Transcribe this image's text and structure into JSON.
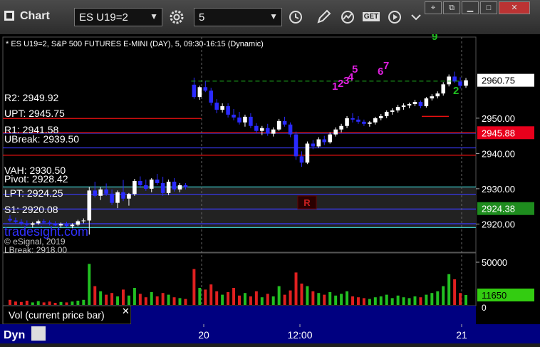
{
  "window": {
    "title": "Chart"
  },
  "toolbar": {
    "symbol": "ES U19=2",
    "interval": "5",
    "studies_label": "GET"
  },
  "chart_data": {
    "type": "candlestick",
    "title": "* ES U19=2, S&P 500 FUTURES E-MINI (DAY), 5, 09:30-16:15 (Dynamic)",
    "ylim": [
      2912,
      2973
    ],
    "y_ticks": [
      2920.0,
      2930.0,
      2940.0,
      2950.0
    ],
    "x_tick_labels": [
      "20",
      "12:00",
      "21"
    ],
    "last_price": 2960.75,
    "price_tags": [
      {
        "value": 2960.75,
        "label": "2960.75",
        "bg": "#ffffff",
        "fg": "#000000"
      },
      {
        "value": 2945.88,
        "label": "2945.88",
        "bg": "#e8001c",
        "fg": "#ffffff"
      },
      {
        "value": 2924.38,
        "label": "2924.38",
        "bg": "#1e8c1e",
        "fg": "#ffffff"
      }
    ],
    "levels": [
      {
        "label": "R2: 2949.92",
        "value": 2949.92,
        "color": "#e81010"
      },
      {
        "label": "UPT: 2945.75",
        "value": 2945.75,
        "color": "#3b3bff"
      },
      {
        "label": "R1: 2941.58",
        "value": 2941.58,
        "color": "#3b3bff"
      },
      {
        "label": "UBreak: 2939.50",
        "value": 2939.5,
        "color": "#e81010"
      },
      {
        "label": "VAH: 2930.50",
        "value": 2930.5,
        "color": "#3cc8c8"
      },
      {
        "label": "Pivot: 2928.42",
        "value": 2928.42,
        "color": "#3b3bff"
      },
      {
        "label": "LPT: 2924.25",
        "value": 2924.25,
        "color": "#3b3bff"
      },
      {
        "label": "S1: 2920.08",
        "value": 2920.08,
        "color": "#3b3bff"
      }
    ],
    "level_lines_extra": [
      {
        "value": 2945.88,
        "color": "#e81010"
      },
      {
        "value": 2919.0,
        "color": "#3cc8c8"
      }
    ],
    "value_area": [
      2919.0,
      2930.5
    ],
    "annotations": [
      {
        "text": "1",
        "color": "#e020e0"
      },
      {
        "text": "2",
        "color": "#e020e0"
      },
      {
        "text": "3",
        "color": "#e020e0"
      },
      {
        "text": "4",
        "color": "#e020e0"
      },
      {
        "text": "5",
        "color": "#e020e0"
      },
      {
        "text": "6",
        "color": "#e020e0"
      },
      {
        "text": "7",
        "color": "#e020e0"
      },
      {
        "text": "9",
        "color": "#20c020"
      },
      {
        "text": "2",
        "color": "#20c020"
      }
    ],
    "marker": "R",
    "watermark": "tradesight.com",
    "copyright": "© eSignal, 2019",
    "partial_label": "LBreak: 2918.00",
    "volume": {
      "ylim": [
        0,
        60000
      ],
      "ticks": [
        50000
      ],
      "tick_labels": [
        "50000"
      ],
      "zero_label": "0",
      "last_value": 11650,
      "last_label": "11650"
    },
    "candles": [
      [
        2921.5,
        2922.5,
        2920.5,
        2921.0
      ],
      [
        2921.0,
        2921.8,
        2920.2,
        2920.6
      ],
      [
        2920.6,
        2921.4,
        2919.6,
        2920.2
      ],
      [
        2920.2,
        2921.0,
        2919.4,
        2919.8
      ],
      [
        2919.8,
        2920.6,
        2919.0,
        2920.2
      ],
      [
        2920.2,
        2921.2,
        2919.8,
        2920.8
      ],
      [
        2920.8,
        2921.4,
        2920.0,
        2920.4
      ],
      [
        2920.4,
        2921.0,
        2919.6,
        2920.0
      ],
      [
        2920.0,
        2920.8,
        2919.4,
        2919.6
      ],
      [
        2919.6,
        2920.4,
        2919.0,
        2920.0
      ],
      [
        2920.0,
        2920.6,
        2919.2,
        2919.4
      ],
      [
        2919.4,
        2920.2,
        2918.8,
        2919.8
      ],
      [
        2919.8,
        2921.2,
        2919.4,
        2920.8
      ],
      [
        2920.8,
        2921.6,
        2920.2,
        2921.0
      ],
      [
        2921.0,
        2930.5,
        2917.0,
        2929.5
      ],
      [
        2929.5,
        2932.0,
        2927.5,
        2928.0
      ],
      [
        2928.0,
        2930.5,
        2926.8,
        2929.8
      ],
      [
        2929.8,
        2931.5,
        2928.0,
        2928.6
      ],
      [
        2928.6,
        2929.8,
        2925.4,
        2926.0
      ],
      [
        2926.0,
        2929.5,
        2924.5,
        2929.0
      ],
      [
        2929.0,
        2932.5,
        2926.5,
        2927.2
      ],
      [
        2927.2,
        2928.8,
        2925.2,
        2928.5
      ],
      [
        2928.5,
        2932.8,
        2928.0,
        2932.2
      ],
      [
        2932.2,
        2933.5,
        2930.2,
        2931.0
      ],
      [
        2931.0,
        2932.6,
        2929.4,
        2930.0
      ],
      [
        2930.0,
        2933.0,
        2929.0,
        2932.6
      ],
      [
        2932.6,
        2934.2,
        2931.0,
        2931.6
      ],
      [
        2931.6,
        2933.4,
        2928.0,
        2928.8
      ],
      [
        2928.8,
        2932.6,
        2928.2,
        2932.0
      ],
      [
        2932.0,
        2933.0,
        2929.2,
        2929.8
      ],
      [
        2929.8,
        2931.6,
        2929.0,
        2931.0
      ],
      [
        2931.0,
        2931.6,
        2929.8,
        2930.4
      ],
      [
        2959.5,
        2961.5,
        2955.5,
        2956.0
      ],
      [
        2956.0,
        2959.2,
        2955.2,
        2958.8
      ],
      [
        2958.8,
        2960.6,
        2957.4,
        2957.8
      ],
      [
        2957.8,
        2958.6,
        2953.6,
        2954.4
      ],
      [
        2954.4,
        2955.4,
        2951.4,
        2952.4
      ],
      [
        2952.4,
        2954.2,
        2951.6,
        2953.4
      ],
      [
        2953.4,
        2954.2,
        2950.2,
        2951.0
      ],
      [
        2951.0,
        2952.6,
        2949.4,
        2950.2
      ],
      [
        2950.2,
        2951.8,
        2948.2,
        2948.8
      ],
      [
        2948.8,
        2951.0,
        2947.6,
        2950.4
      ],
      [
        2950.4,
        2951.4,
        2947.2,
        2947.8
      ],
      [
        2947.8,
        2948.6,
        2945.8,
        2946.4
      ],
      [
        2946.4,
        2947.8,
        2945.2,
        2947.2
      ],
      [
        2947.2,
        2948.4,
        2945.0,
        2945.6
      ],
      [
        2945.6,
        2947.4,
        2944.8,
        2946.8
      ],
      [
        2946.8,
        2949.8,
        2946.4,
        2949.2
      ],
      [
        2949.2,
        2950.4,
        2947.6,
        2948.2
      ],
      [
        2948.2,
        2948.8,
        2944.6,
        2945.4
      ],
      [
        2945.4,
        2946.2,
        2938.2,
        2939.2
      ],
      [
        2939.2,
        2940.6,
        2936.2,
        2937.4
      ],
      [
        2937.4,
        2943.4,
        2937.0,
        2942.8
      ],
      [
        2942.8,
        2943.8,
        2941.2,
        2942.0
      ],
      [
        2942.0,
        2944.6,
        2941.6,
        2944.0
      ],
      [
        2944.0,
        2945.0,
        2942.4,
        2943.2
      ],
      [
        2943.2,
        2946.0,
        2942.8,
        2945.4
      ],
      [
        2945.4,
        2947.4,
        2944.8,
        2946.8
      ],
      [
        2946.8,
        2948.4,
        2946.0,
        2947.8
      ],
      [
        2947.8,
        2950.6,
        2947.2,
        2950.0
      ],
      [
        2950.0,
        2951.4,
        2948.8,
        2949.6
      ],
      [
        2949.6,
        2950.6,
        2948.4,
        2949.0
      ],
      [
        2949.0,
        2949.6,
        2947.8,
        2948.4
      ],
      [
        2948.4,
        2949.2,
        2947.6,
        2948.8
      ],
      [
        2948.8,
        2950.4,
        2948.2,
        2950.0
      ],
      [
        2950.0,
        2951.2,
        2949.4,
        2950.6
      ],
      [
        2950.6,
        2952.2,
        2950.0,
        2951.8
      ],
      [
        2951.8,
        2952.8,
        2951.0,
        2952.2
      ],
      [
        2952.2,
        2953.8,
        2951.6,
        2953.2
      ],
      [
        2953.2,
        2954.2,
        2952.4,
        2953.6
      ],
      [
        2953.6,
        2954.4,
        2952.8,
        2954.0
      ],
      [
        2954.0,
        2955.2,
        2953.4,
        2954.6
      ],
      [
        2954.6,
        2955.0,
        2952.8,
        2953.4
      ],
      [
        2953.4,
        2956.0,
        2953.0,
        2955.6
      ],
      [
        2955.6,
        2956.8,
        2955.0,
        2956.2
      ],
      [
        2956.2,
        2957.6,
        2955.6,
        2957.0
      ],
      [
        2957.0,
        2960.2,
        2956.4,
        2959.6
      ],
      [
        2959.6,
        2962.4,
        2959.0,
        2961.8
      ],
      [
        2961.8,
        2963.2,
        2960.0,
        2960.4
      ],
      [
        2960.4,
        2961.6,
        2958.4,
        2959.2
      ],
      [
        2959.2,
        2961.4,
        2958.6,
        2960.75
      ]
    ],
    "volumes": [
      6000,
      4000,
      3500,
      5000,
      3000,
      4500,
      3000,
      4000,
      2500,
      3500,
      3000,
      4000,
      5000,
      6000,
      48000,
      22000,
      16000,
      12000,
      14000,
      10000,
      18000,
      11000,
      20000,
      13000,
      9000,
      15000,
      10000,
      14000,
      12000,
      9000,
      8000,
      7000,
      42000,
      20000,
      18000,
      24000,
      16000,
      12000,
      15000,
      20000,
      11000,
      14000,
      10000,
      16000,
      9000,
      13000,
      10000,
      22000,
      12000,
      17000,
      38000,
      25000,
      22000,
      16000,
      14000,
      12000,
      15000,
      11000,
      13000,
      16000,
      10000,
      9000,
      8000,
      7000,
      9000,
      10000,
      12000,
      8000,
      11000,
      9000,
      8000,
      10000,
      9000,
      12000,
      14000,
      16000,
      22000,
      36000,
      30000,
      14000,
      11650
    ]
  },
  "indicator_panel": {
    "label": "Vol (current price bar)"
  },
  "footer": {
    "status": "Dyn"
  }
}
